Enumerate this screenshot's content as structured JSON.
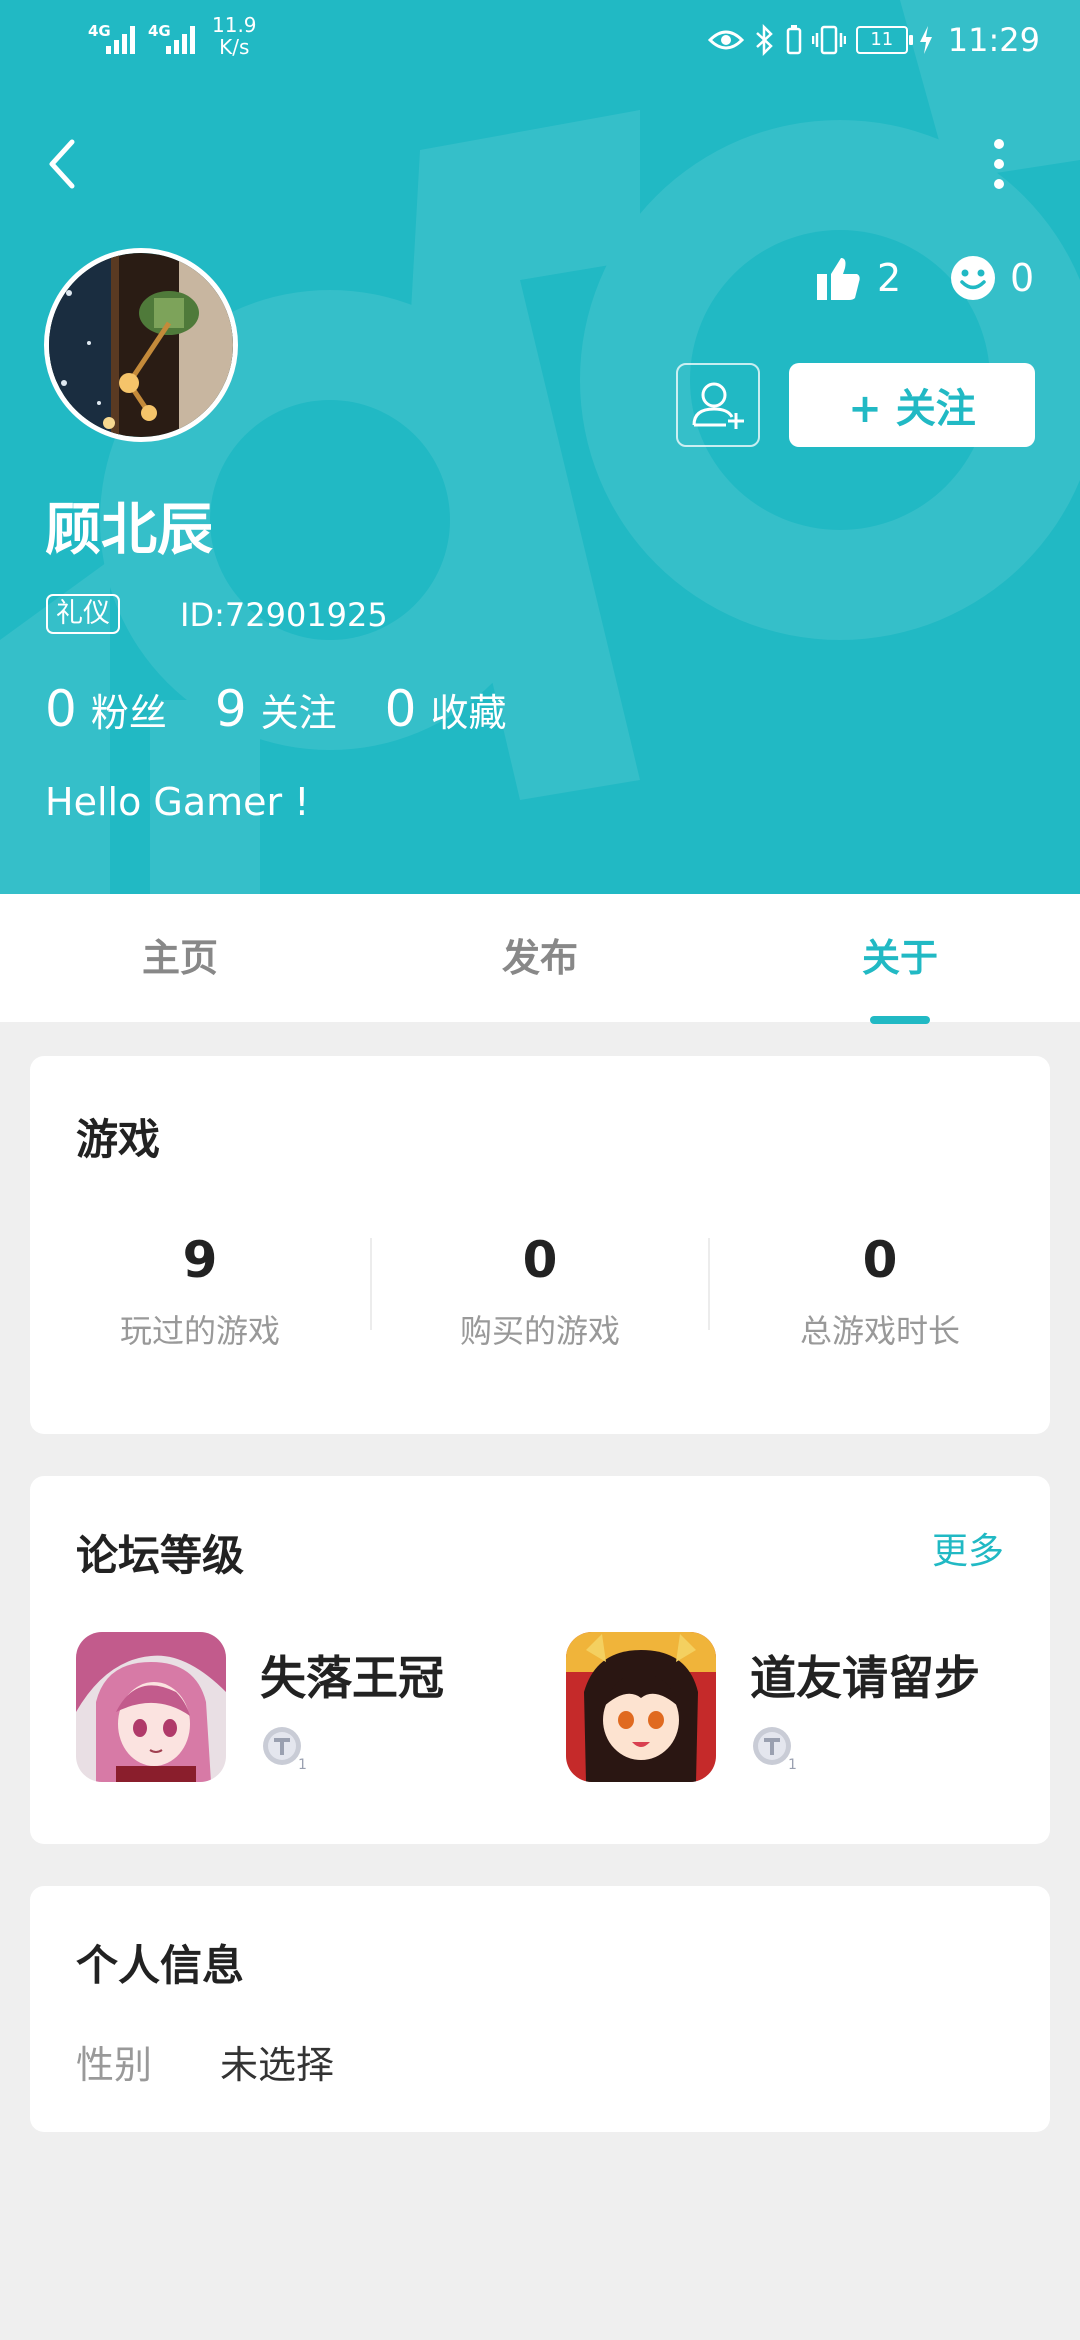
{
  "status_bar": {
    "network_1": "4G",
    "network_2": "4G",
    "speed_value": "11.9",
    "speed_unit": "K/s",
    "battery": "11",
    "time": "11:29"
  },
  "profile": {
    "likes": "2",
    "smiles": "0",
    "follow_label": "+ 关注",
    "username": "顾北辰",
    "badge": "礼仪",
    "user_id": "ID:72901925",
    "stats": [
      {
        "value": "0",
        "label": "粉丝"
      },
      {
        "value": "9",
        "label": "关注"
      },
      {
        "value": "0",
        "label": "收藏"
      }
    ],
    "bio": "Hello Gamer !"
  },
  "tabs": [
    {
      "label": "主页",
      "active": false
    },
    {
      "label": "发布",
      "active": false
    },
    {
      "label": "关于",
      "active": true
    }
  ],
  "games": {
    "title": "游戏",
    "stats": [
      {
        "value": "9",
        "label": "玩过的游戏"
      },
      {
        "value": "0",
        "label": "购买的游戏"
      },
      {
        "value": "0",
        "label": "总游戏时长"
      }
    ]
  },
  "forum": {
    "title": "论坛等级",
    "more_label": "更多",
    "items": [
      {
        "name": "失落王冠",
        "level": "1"
      },
      {
        "name": "道友请留步",
        "level": "1"
      }
    ]
  },
  "personal_info": {
    "title": "个人信息",
    "gender_label": "性别",
    "gender_value": "未选择"
  },
  "colors": {
    "accent": "#21b9c4",
    "background": "#efefef",
    "card": "#ffffff"
  }
}
